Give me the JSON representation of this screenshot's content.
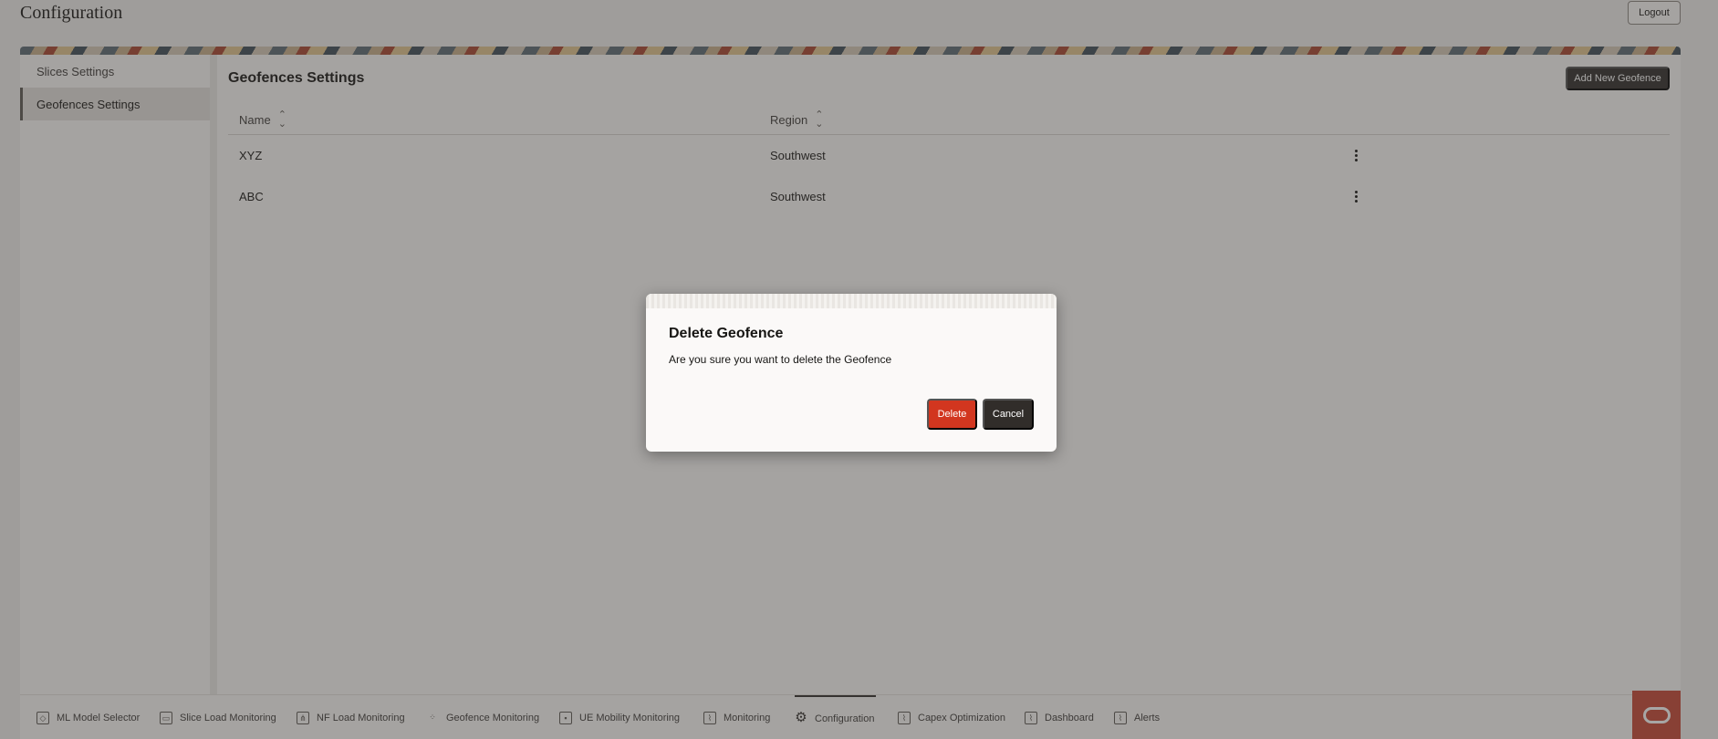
{
  "header": {
    "title": "Configuration",
    "logout_label": "Logout"
  },
  "sidebar": {
    "items": [
      {
        "label": "Slices Settings",
        "active": false
      },
      {
        "label": "Geofences Settings",
        "active": true
      }
    ]
  },
  "main": {
    "title": "Geofences Settings",
    "add_button_label": "Add New Geofence",
    "table": {
      "columns": [
        "Name",
        "Region"
      ],
      "rows": [
        {
          "name": "XYZ",
          "region": "Southwest"
        },
        {
          "name": "ABC",
          "region": "Southwest"
        }
      ]
    }
  },
  "dialog": {
    "title": "Delete Geofence",
    "message": "Are you sure you want to delete the Geofence",
    "delete_label": "Delete",
    "cancel_label": "Cancel"
  },
  "bottom_nav": {
    "items": [
      {
        "label": "ML Model Selector",
        "icon": "cube-icon"
      },
      {
        "label": "Slice Load Monitoring",
        "icon": "monitor-icon"
      },
      {
        "label": "NF Load Monitoring",
        "icon": "network-icon"
      },
      {
        "label": "Geofence Monitoring",
        "icon": "geofence-icon"
      },
      {
        "label": "UE Mobility Monitoring",
        "icon": "device-icon"
      },
      {
        "label": "Monitoring",
        "icon": "chart-icon"
      },
      {
        "label": "Configuration",
        "icon": "gear-icon",
        "active": true
      },
      {
        "label": "Capex Optimization",
        "icon": "chart-icon"
      },
      {
        "label": "Dashboard",
        "icon": "chart-icon"
      },
      {
        "label": "Alerts",
        "icon": "chart-icon"
      }
    ]
  },
  "colors": {
    "primary_dark": "#312d2a",
    "danger": "#d2361f",
    "oracle_red": "#c74634",
    "background": "#fbf9f8"
  }
}
